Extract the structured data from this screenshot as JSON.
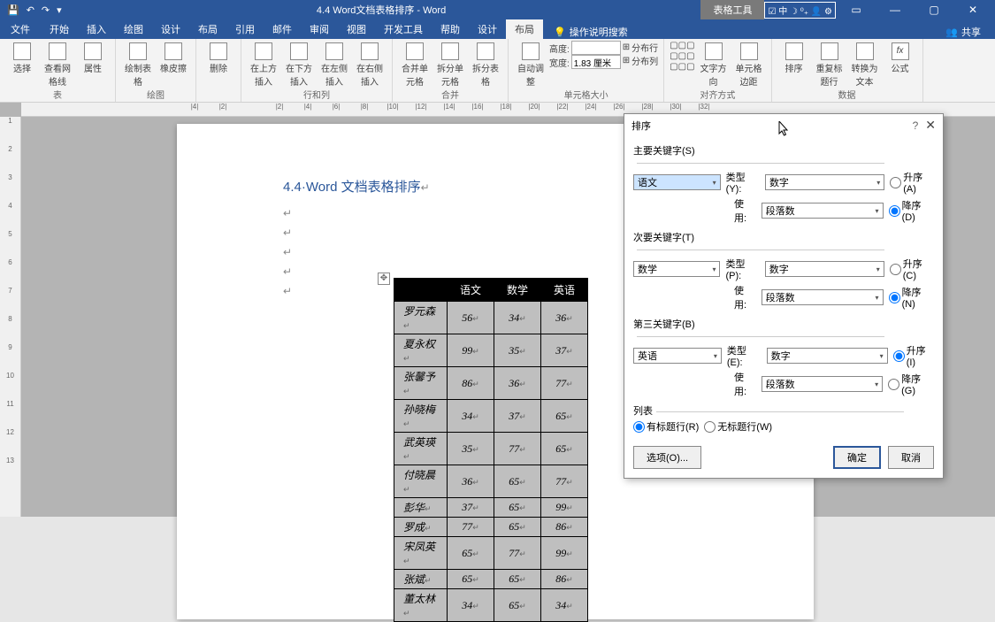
{
  "titlebar": {
    "doc_title": "4.4 Word文档表格排序 - Word",
    "context_tab": "表格工具",
    "quick_icons": [
      "日",
      "↩",
      "↪",
      "品"
    ]
  },
  "tabs": {
    "items": [
      "文件",
      "开始",
      "插入",
      "绘图",
      "设计",
      "布局",
      "引用",
      "邮件",
      "审阅",
      "视图",
      "开发工具",
      "帮助",
      "设计",
      "布局"
    ],
    "active_index": 13,
    "tell_me": "操作说明搜索",
    "share": "共享"
  },
  "ribbon": {
    "g0": {
      "label": "表",
      "b0": "选择",
      "b1": "查看网格线",
      "b2": "属性"
    },
    "g1": {
      "label": "绘图",
      "b0": "绘制表格",
      "b1": "橡皮擦"
    },
    "g2": {
      "label": "",
      "b0": "删除"
    },
    "g3": {
      "label": "行和列",
      "b0": "在上方插入",
      "b1": "在下方插入",
      "b2": "在左侧插入",
      "b3": "在右侧插入"
    },
    "g4": {
      "label": "合并",
      "b0": "合并单元格",
      "b1": "拆分单元格",
      "b2": "拆分表格"
    },
    "g5": {
      "label": "单元格大小",
      "b0": "自动调整",
      "height_lbl": "高度:",
      "height_val": "",
      "width_lbl": "宽度:",
      "width_val": "1.83 厘米",
      "dist_row": "分布行",
      "dist_col": "分布列"
    },
    "g6": {
      "label": "对齐方式",
      "b0": "文字方向",
      "b1": "单元格边距"
    },
    "g7": {
      "label": "数据",
      "b0": "排序",
      "b1": "重复标题行",
      "b2": "转换为文本",
      "b3": "公式",
      "fx": "fx"
    }
  },
  "document": {
    "heading": "4.4·Word 文档表格排序",
    "ruler_nums": [
      "|4|",
      "|2|",
      "",
      "|2|",
      "|4|",
      "|6|",
      "|8|",
      "|10|",
      "|12|",
      "|14|",
      "|16|",
      "|18|",
      "|20|",
      "|22|",
      "|24|",
      "|26|",
      "|28|",
      "|30|",
      "|32|"
    ],
    "table": {
      "headers": [
        "",
        "语文",
        "数学",
        "英语"
      ],
      "rows": [
        [
          "罗元森",
          "56",
          "34",
          "36"
        ],
        [
          "夏永权",
          "99",
          "35",
          "37"
        ],
        [
          "张馨予",
          "86",
          "36",
          "77"
        ],
        [
          "孙晓梅",
          "34",
          "37",
          "65"
        ],
        [
          "武英瑛",
          "35",
          "77",
          "65"
        ],
        [
          "付晓晨",
          "36",
          "65",
          "77"
        ],
        [
          "彭华",
          "37",
          "65",
          "99"
        ],
        [
          "罗成",
          "77",
          "65",
          "86"
        ],
        [
          "宋凤英",
          "65",
          "77",
          "99"
        ],
        [
          "张斌",
          "65",
          "65",
          "86"
        ],
        [
          "董太林",
          "34",
          "65",
          "34"
        ]
      ]
    }
  },
  "dialog": {
    "title": "排序",
    "primary_label": "主要关键字(S)",
    "secondary_label": "次要关键字(T)",
    "third_label": "第三关键字(B)",
    "type_lbl_y": "类型(Y):",
    "type_lbl_p": "类型(P):",
    "type_lbl_e": "类型(E):",
    "using_lbl": "使用:",
    "key1": "语文",
    "key2": "数学",
    "key3": "英语",
    "type_val": "数字",
    "using_val": "段落数",
    "asc_a": "升序(A)",
    "desc_d": "降序(D)",
    "asc_c": "升序(C)",
    "desc_n": "降序(N)",
    "asc_i": "升序(I)",
    "desc_g": "降序(G)",
    "list_label": "列表",
    "header_row": "有标题行(R)",
    "no_header_row": "无标题行(W)",
    "options_btn": "选项(O)...",
    "ok_btn": "确定",
    "cancel_btn": "取消"
  }
}
